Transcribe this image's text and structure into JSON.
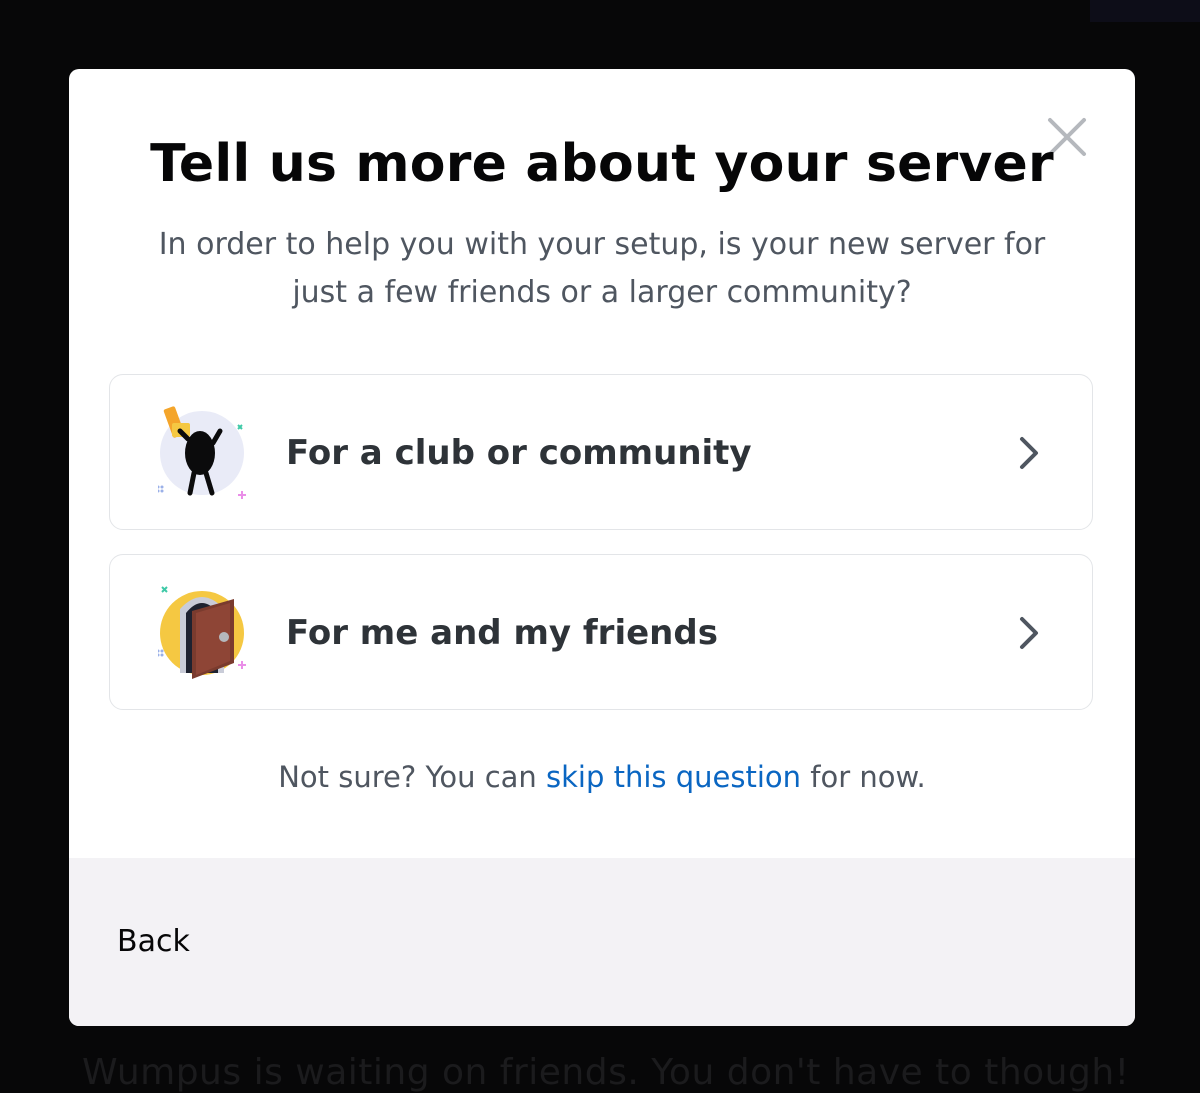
{
  "background": {
    "peek_text": "Wumpus is waiting on friends. You don't have to though!"
  },
  "modal": {
    "title": "Tell us more about your server",
    "subtitle": "In order to help you with your setup, is your new server for just a few friends or a larger community?",
    "close_icon": "close-icon",
    "options": [
      {
        "label": "For a club or community",
        "icon": "club-community-illustration",
        "chevron": "chevron-right-icon"
      },
      {
        "label": "For me and my friends",
        "icon": "friends-door-illustration",
        "chevron": "chevron-right-icon"
      }
    ],
    "skip": {
      "prefix": "Not sure? You can ",
      "link": "skip this question",
      "suffix": " for now."
    },
    "footer": {
      "back_label": "Back"
    }
  },
  "colors": {
    "backdrop": "#070708",
    "modal_bg": "#ffffff",
    "footer_bg": "#f3f2f5",
    "title": "#060607",
    "body_text": "#4f5660",
    "link": "#0a66c2",
    "option_border": "#e3e5e8",
    "accent_yellow": "#f5c842",
    "accent_orange": "#f4a52b"
  }
}
